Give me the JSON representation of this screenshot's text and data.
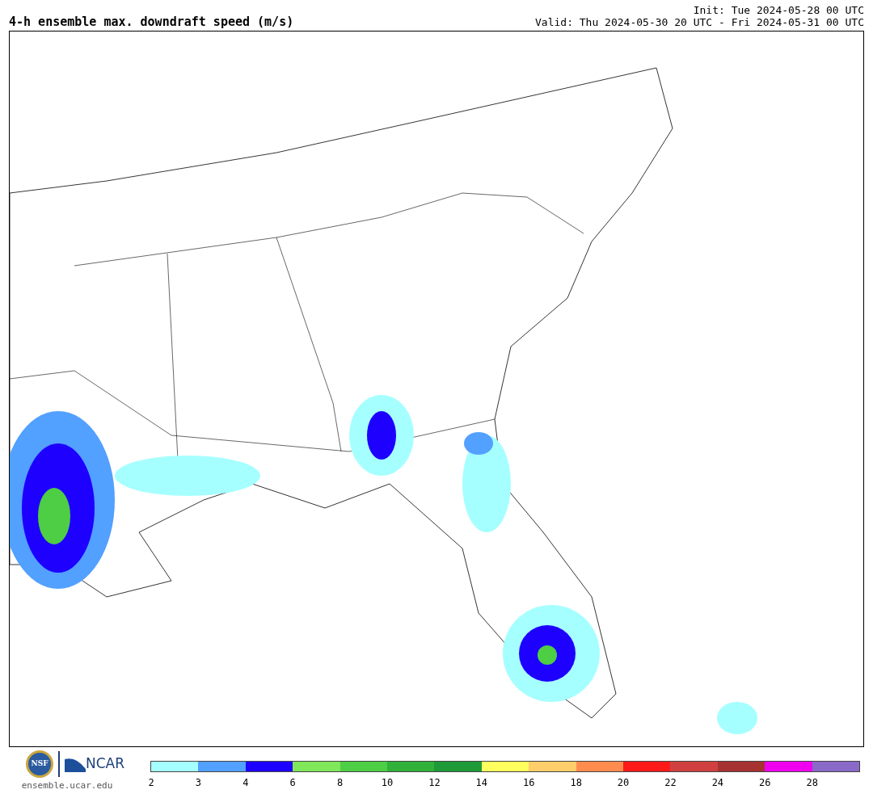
{
  "title": "4-h ensemble max. downdraft speed (m/s)",
  "init": "Init: Tue 2024-05-28 00 UTC",
  "valid": "Valid: Thu 2024-05-30 20 UTC - Fri 2024-05-31 00 UTC",
  "logos": {
    "nsf": "NSF",
    "ncar": "NCAR",
    "site": "ensemble.ucar.edu"
  },
  "colorbar": {
    "bins": [
      {
        "color": "#a6ffff",
        "label": "2"
      },
      {
        "color": "#52a0ff",
        "label": "3"
      },
      {
        "color": "#1e00ff",
        "label": "4"
      },
      {
        "color": "#80e65a",
        "label": "6"
      },
      {
        "color": "#4ece44",
        "label": "8"
      },
      {
        "color": "#30b23a",
        "label": "10"
      },
      {
        "color": "#1f9a38",
        "label": "12"
      },
      {
        "color": "#ffff5e",
        "label": "14"
      },
      {
        "color": "#ffcd6a",
        "label": "16"
      },
      {
        "color": "#ff8c4f",
        "label": "18"
      },
      {
        "color": "#ff1a1a",
        "label": "20"
      },
      {
        "color": "#d04040",
        "label": "22"
      },
      {
        "color": "#a63232",
        "label": "24"
      },
      {
        "color": "#ef00ef",
        "label": "26"
      },
      {
        "color": "#8a6ac8",
        "label": "28"
      }
    ]
  }
}
